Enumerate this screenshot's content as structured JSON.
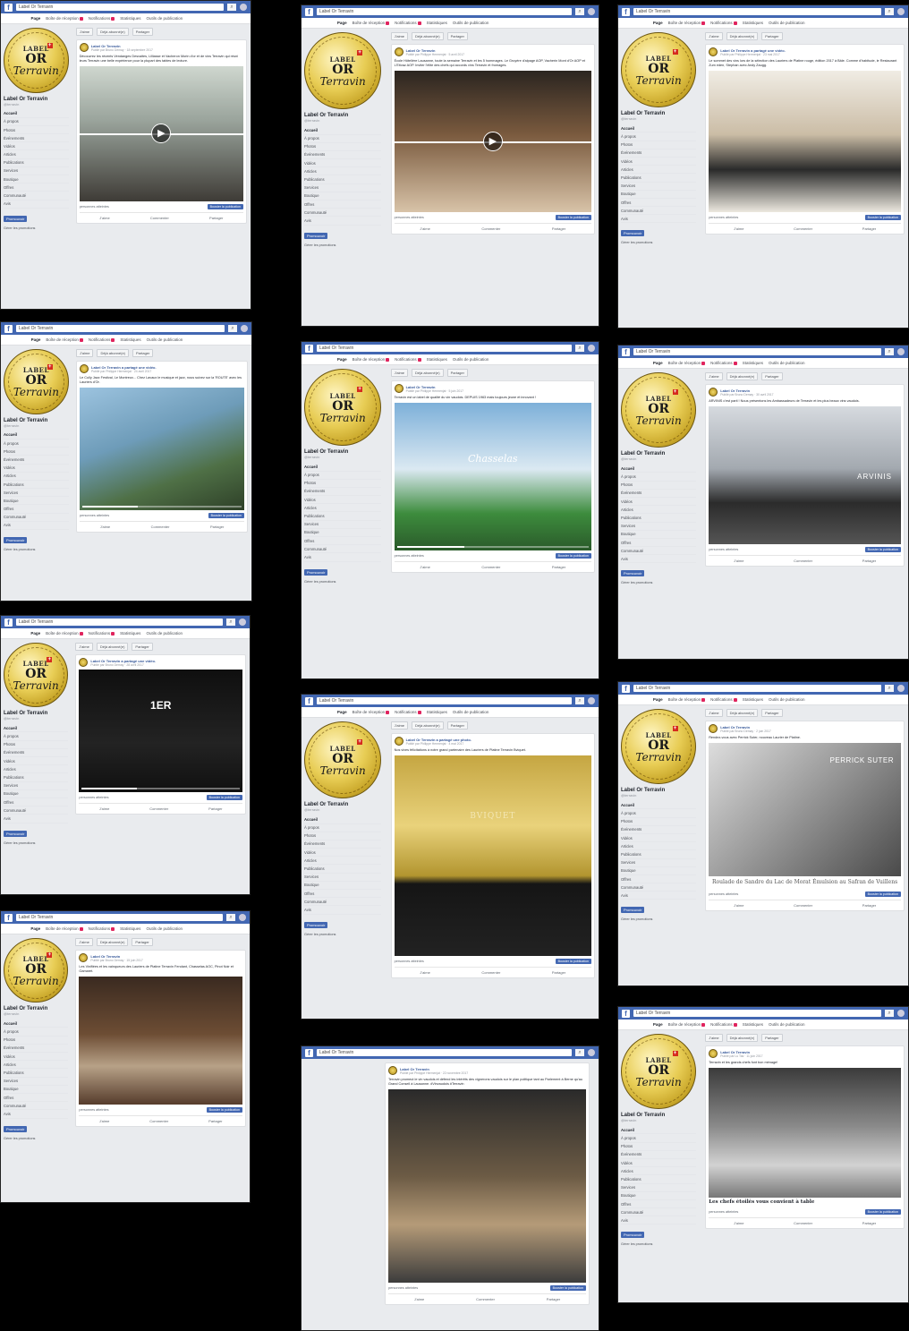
{
  "common": {
    "search_value": "Label Or Terravin",
    "search_icon": "search-icon",
    "brand": {
      "blue": "#4267b2",
      "gold": "#d9b94a"
    },
    "tabs": [
      "Page",
      "Boîte de réception",
      "Notifications",
      "Statistiques",
      "Outils de publication"
    ],
    "logo": {
      "line1": "LABEL",
      "line2": "OR",
      "line3": "Terravin"
    },
    "page_name": "Label Or Terravin",
    "page_handle": "@terravin",
    "nav": [
      "Accueil",
      "À propos",
      "Photos",
      "Événements",
      "Vidéos",
      "Articles",
      "Publications",
      "Services",
      "Boutique",
      "Offres",
      "Communauté",
      "Avis"
    ],
    "promote": "Promouvoir",
    "manage_promotions": "Gérer les promotions",
    "actions": [
      "J'aime",
      "Déjà abonné(e)",
      "Partager"
    ],
    "footer": [
      "J'aime",
      "Commenter",
      "Partager"
    ],
    "boost": "Booster la publication",
    "reach": "personnes atteintes"
  },
  "shots": [
    {
      "author": "Label Or Terravin",
      "meta": "Publié par Bruno Demay · 18 septembre 2017",
      "text": "Découvrez les récents Vendanges Desvaites, Lilliasse et Vacheron Morin d'or et de vins Terravin qui réuni leurs Terravin une belle expérience pour la plupart des tables de lecture.",
      "scene": "people",
      "play": true
    },
    {
      "author": "Label Or Terravin",
      "meta": "Publié par Philippe Hermenjat · 5 avril 2017",
      "text": "École Hôtelière Lausanne, toute la semaine Terravin et les 5 hommages. Le Gruyère d'alpage AOP, Vacherin Mont d'Or AOP et L'Etivaz AOP. Inviter l'élite des chefs qui accords vins Terravin et fromages.",
      "scene": "dinner",
      "play": true
    },
    {
      "author": "Label Or Terravin a partagé une vidéo.",
      "meta": "Publié par Philippe Hermenjat · 23 mai 2017",
      "text": "Le sommet des vins lors de la sélection des Lauriers de Platine rouge, édition 2017 à Bâle. Comme d'habitude, le Restaurant Zum eden, Stephan avec Andy Zaugg.",
      "scene": "toast",
      "play": false
    },
    {
      "author": "Label Or Terravin a partagé une vidéo.",
      "meta": "Publié par Philippe Hermenjat · 24 avril 2017",
      "text": "Le Cully Jazz Festival, Le Montreux... Chez Lavaux le musique et jazz, nous suivez sur la 'ROUTE' avec les Lauriers d'Or.",
      "scene": "lake",
      "play": false
    },
    {
      "author": "Label Or Terravin",
      "meta": "Publié par Philippe Hermenjat · 5 juin 2017",
      "text": "Terravin est un label de qualité du vin vaudois. DEPUIS 1963 mais toujours jeune et innovant !",
      "scene": "sport",
      "overlay": "Chasselas",
      "play": false
    },
    {
      "author": "Label Or Terravin",
      "meta": "Publié par Bruno Demay · 30 avril 2017",
      "text": "ARVINIS c'est parti ! Nous présentons les Ambassadeurs de Terravin et les plus beaux vins vaudois.",
      "scene": "building",
      "overlay": "ARVINIS",
      "play": false
    },
    {
      "author": "Label Or Terravin a partagé une vidéo.",
      "meta": "Publié par Bruno Demay · 28 avril 2017",
      "text": "",
      "scene": "dark",
      "overlay": "1ER",
      "play": false
    },
    {
      "author": "Label Or Terravin a partagé une photo.",
      "meta": "Publié par Philippe Hermenjat · 4 mai 2017",
      "text": "Nos vives félicitations à notre grand partenaire des Lauriers de Platine Terravin Bviquet.",
      "scene": "gold",
      "overlay": "BVIQUET",
      "play": false
    },
    {
      "author": "Label Or Terravin",
      "meta": "Publié par Bruno Demay · 2 juin 2017",
      "text": "Rendez-vous avec Perrick Suter, nouveau Laurier de Platine.",
      "scene": "chef",
      "overlay": "PERRICK SUTER",
      "dish": "Roulade de Sandre du Lac de Morat Émulsion au Safran de Vuillens",
      "play": false
    },
    {
      "author": "Label Or Terravin",
      "meta": "Publié par Bruno Demay · 15 juin 2017",
      "text": "Les Vinifiées et les vainqueurs des Lauriers de Platine Terravin Fendant, Chasselas AOC, Pinot Noir et Gamaret.",
      "scene": "wine",
      "play": false
    },
    {
      "author": "Label Or Terravin",
      "meta": "Publié par Philippe Hermenjat · 22 novembre 2017",
      "text": "Terravin promeut le vin vaudois et défend les intérêts des vignerons vaudois sur le plan politique tant au Parlement à Berne qu'au Grand Conseil à Lausanne. #Vinvaudois #Terravin",
      "scene": "event",
      "play": false
    },
    {
      "author": "Label Or Terravin",
      "meta": "Publié par Lu Tas · 11 juin 2017",
      "text": "Terravin et les grands chefs font bon ménage!",
      "scene": "kitchen",
      "headline": "Les chefs étoilés vous convient à table",
      "play": false
    }
  ]
}
